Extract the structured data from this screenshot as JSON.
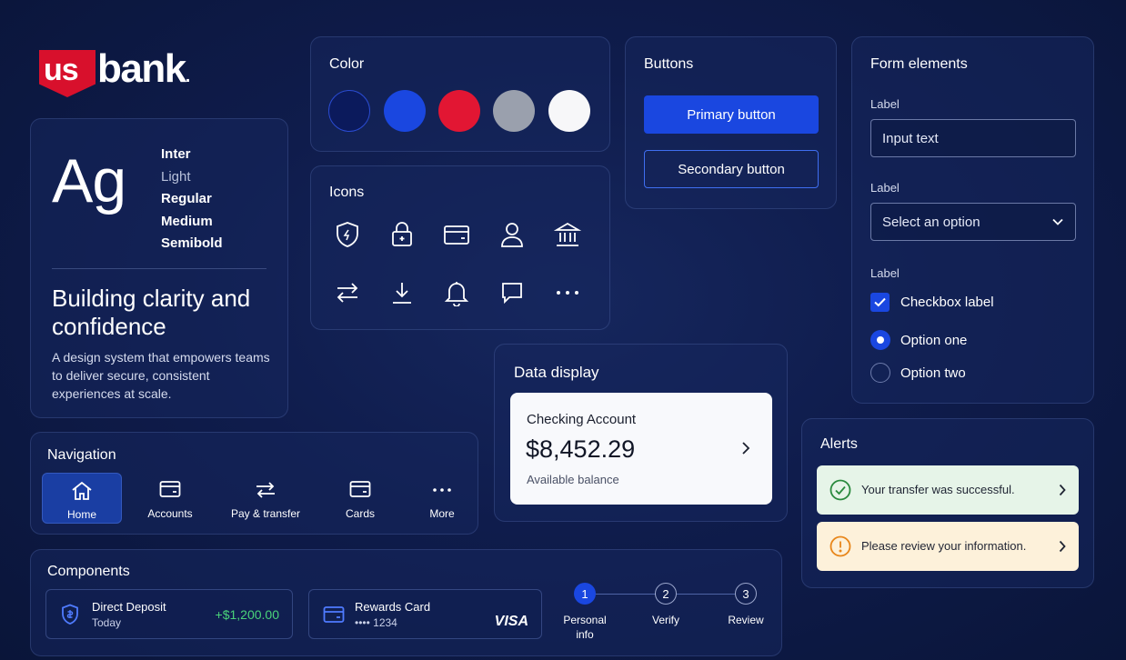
{
  "brand": {
    "logo_us": "us",
    "logo_bank": "bank",
    "logo_dot": "."
  },
  "typography": {
    "sample": "Ag",
    "font_name": "Inter",
    "weights": [
      "Light",
      "Regular",
      "Medium",
      "Semibold"
    ],
    "headline": "Building clarity and confidence",
    "body": "A design system that empowers teams to deliver secure, consistent experiences at scale."
  },
  "color": {
    "title": "Color",
    "swatches": [
      "#0b1a5c",
      "#1a47e0",
      "#e21633",
      "#9aa0ad",
      "#f7f7f9"
    ]
  },
  "icons": {
    "title": "Icons",
    "row1": [
      "shield-icon",
      "lock-icon",
      "card-icon",
      "user-icon",
      "bank-icon"
    ],
    "row2": [
      "transfer-icon",
      "download-icon",
      "bell-icon",
      "chat-icon",
      "more-icon"
    ]
  },
  "buttons": {
    "title": "Buttons",
    "primary": "Primary button",
    "secondary": "Secondary button"
  },
  "form": {
    "title": "Form elements",
    "label1": "Label",
    "input_value": "Input text",
    "label2": "Label",
    "select_value": "Select an option",
    "label3": "Label",
    "checkbox_label": "Checkbox label",
    "checkbox_checked": true,
    "radio_one": "Option one",
    "radio_two": "Option two",
    "radio_selected": "Option one"
  },
  "data_display": {
    "title": "Data display",
    "account_name": "Checking Account",
    "balance": "$8,452.29",
    "balance_label": "Available balance"
  },
  "navigation": {
    "title": "Navigation",
    "items": [
      {
        "label": "Home",
        "icon": "home-icon",
        "active": true
      },
      {
        "label": "Accounts",
        "icon": "card-icon",
        "active": false
      },
      {
        "label": "Pay & transfer",
        "icon": "transfer-icon",
        "active": false
      },
      {
        "label": "Cards",
        "icon": "card-icon",
        "active": false
      },
      {
        "label": "More",
        "icon": "more-icon",
        "active": false
      }
    ]
  },
  "alerts": {
    "title": "Alerts",
    "success": "Your transfer was successful.",
    "warning": "Please review your information."
  },
  "components": {
    "title": "Components",
    "deposit": {
      "title": "Direct Deposit",
      "sub": "Today",
      "amount": "+$1,200.00"
    },
    "card": {
      "title": "Rewards Card",
      "sub": "•••• 1234",
      "network": "VISA"
    },
    "steps": [
      {
        "num": "1",
        "label": "Personal info",
        "active": true
      },
      {
        "num": "2",
        "label": "Verify",
        "active": false
      },
      {
        "num": "3",
        "label": "Review",
        "active": false
      }
    ]
  }
}
